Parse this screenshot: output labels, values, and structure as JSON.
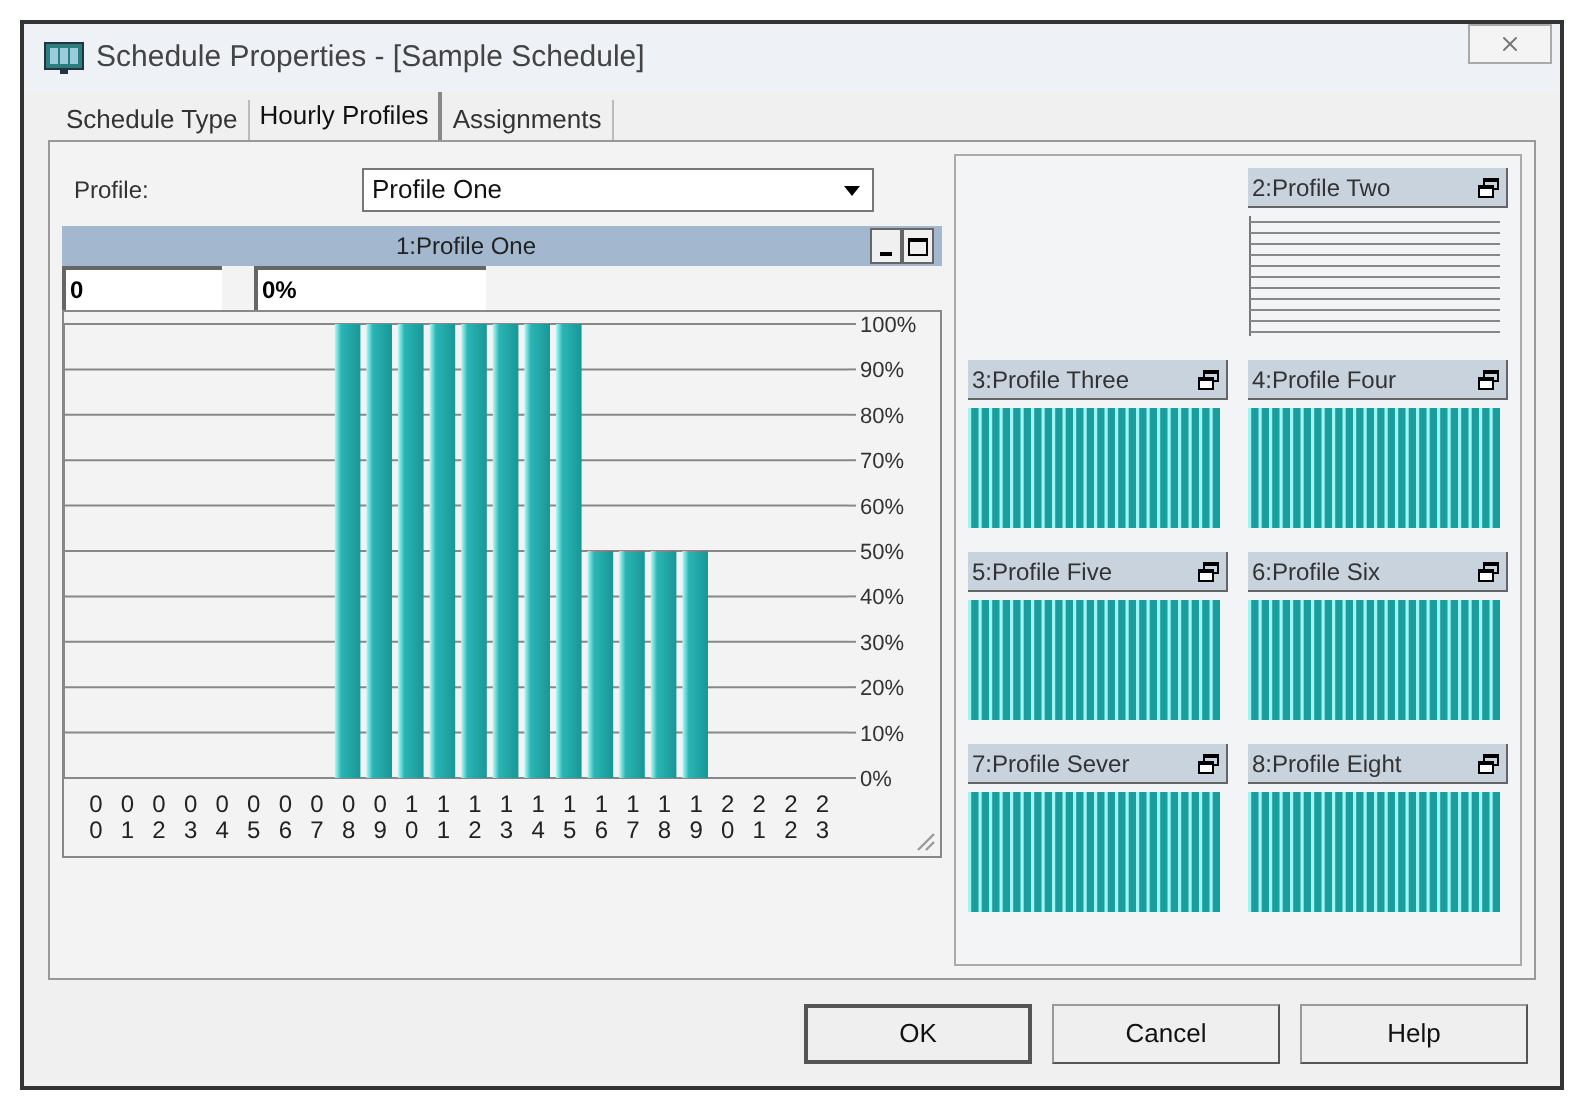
{
  "window": {
    "title": "Schedule Properties - [Sample Schedule]"
  },
  "tabs": [
    {
      "label": "Schedule Type",
      "selected": false
    },
    {
      "label": "Hourly Profiles",
      "selected": true
    },
    {
      "label": "Assignments",
      "selected": false
    }
  ],
  "profile_select": {
    "label": "Profile:",
    "value": "Profile One"
  },
  "profile_window": {
    "title": "1:Profile One",
    "hour_field": "0",
    "value_field": "0%",
    "chart_data": {
      "type": "bar",
      "categories": [
        "00",
        "01",
        "02",
        "03",
        "04",
        "05",
        "06",
        "07",
        "08",
        "09",
        "10",
        "11",
        "12",
        "13",
        "14",
        "15",
        "16",
        "17",
        "18",
        "19",
        "20",
        "21",
        "22",
        "23"
      ],
      "values": [
        0,
        0,
        0,
        0,
        0,
        0,
        0,
        0,
        100,
        100,
        100,
        100,
        100,
        100,
        100,
        100,
        50,
        50,
        50,
        50,
        0,
        0,
        0,
        0
      ],
      "ylim": [
        0,
        100
      ],
      "grid": true,
      "yticks": [
        {
          "value": 0,
          "label": "0%"
        },
        {
          "value": 10,
          "label": "10%"
        },
        {
          "value": 20,
          "label": "20%"
        },
        {
          "value": 30,
          "label": "30%"
        },
        {
          "value": 40,
          "label": "40%"
        },
        {
          "value": 50,
          "label": "50%"
        },
        {
          "value": 60,
          "label": "60%"
        },
        {
          "value": 70,
          "label": "70%"
        },
        {
          "value": 80,
          "label": "80%"
        },
        {
          "value": 90,
          "label": "90%"
        },
        {
          "value": 100,
          "label": "100%"
        }
      ]
    }
  },
  "thumbnails": [
    {
      "title": "2:Profile Two",
      "kind": "empty"
    },
    {
      "title": "3:Profile Three",
      "kind": "bars"
    },
    {
      "title": "4:Profile Four",
      "kind": "bars"
    },
    {
      "title": "5:Profile Five",
      "kind": "bars"
    },
    {
      "title": "6:Profile Six",
      "kind": "bars"
    },
    {
      "title": "7:Profile Sever",
      "kind": "bars"
    },
    {
      "title": "8:Profile Eight",
      "kind": "bars"
    }
  ],
  "buttons": [
    {
      "label": "OK",
      "default": true
    },
    {
      "label": "Cancel",
      "default": false
    },
    {
      "label": "Help",
      "default": false
    }
  ]
}
